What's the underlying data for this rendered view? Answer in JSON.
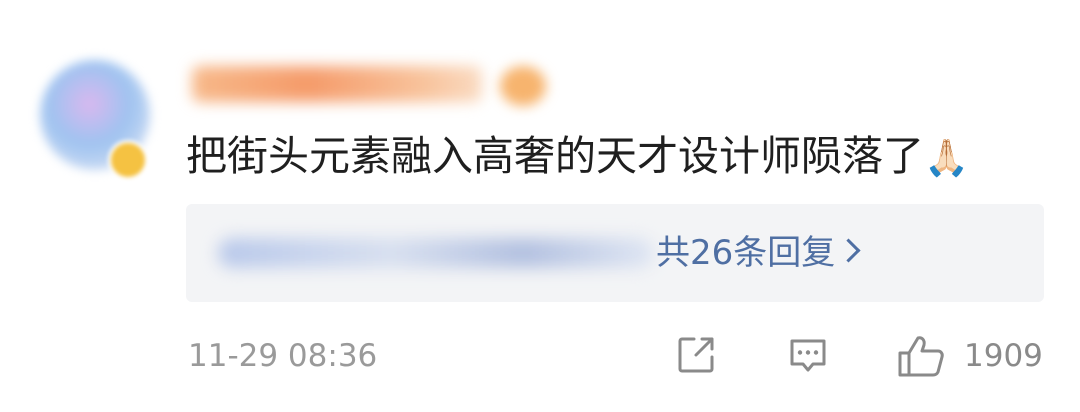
{
  "comment": {
    "text": "把街头元素融入高奢的天才设计师陨落了",
    "emoji": "🙏🏻"
  },
  "replies": {
    "summary": "共26条回复"
  },
  "footer": {
    "timestamp": "11-29 08:36",
    "like_count": "1909"
  },
  "icons": {
    "share": "share-icon",
    "reply": "comment-icon",
    "like": "thumbs-up-icon",
    "chevron": "chevron-right-icon"
  },
  "colors": {
    "link": "#4f6fa3",
    "text": "#1f1f1f",
    "muted": "#9a9a9a",
    "reply_bg": "#f3f4f6"
  }
}
